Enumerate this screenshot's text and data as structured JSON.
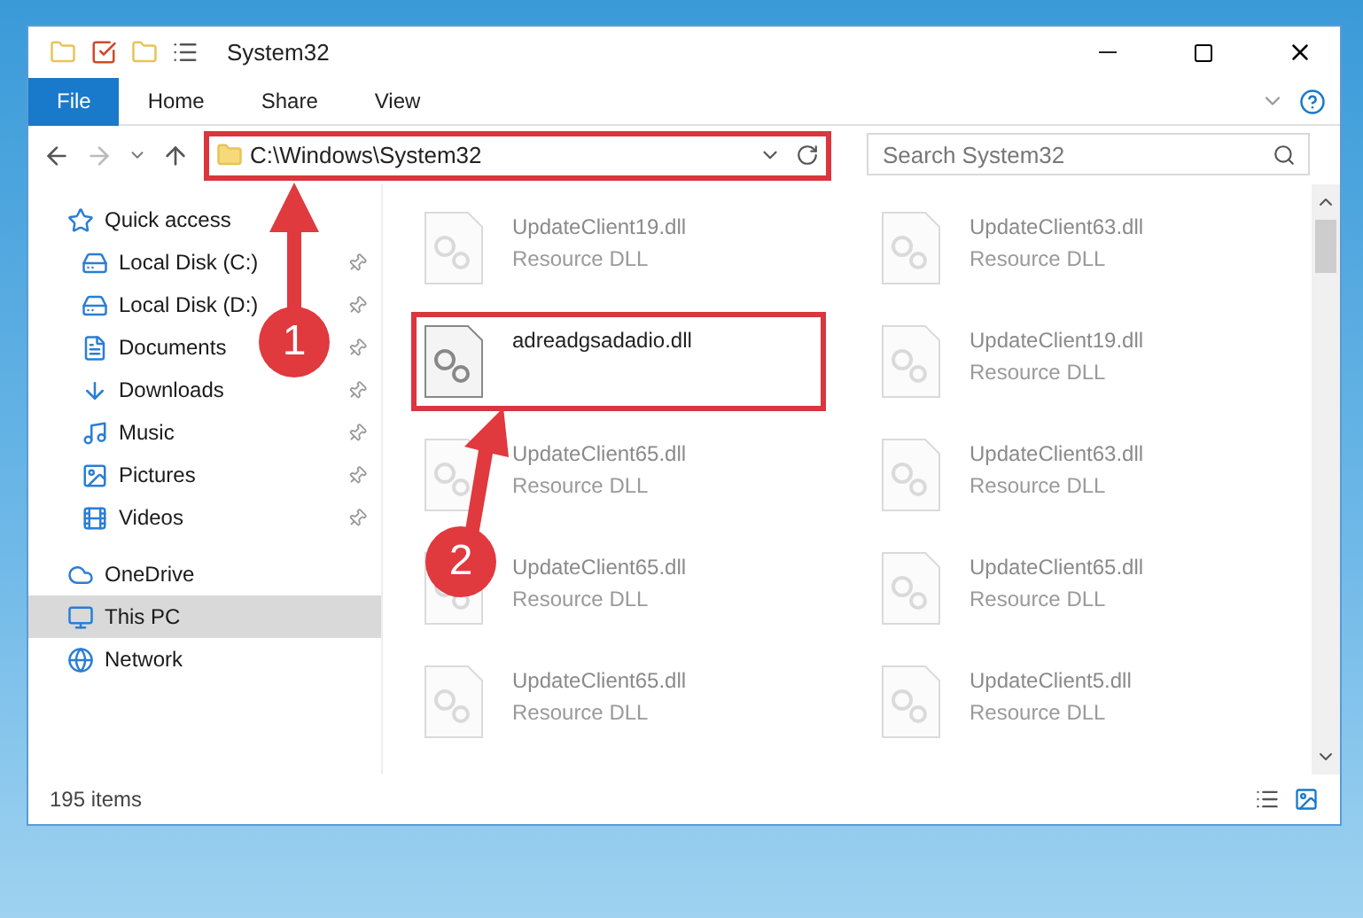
{
  "window": {
    "title": "System32"
  },
  "ribbon_tabs": [
    {
      "label": "File",
      "selected": true
    },
    {
      "label": "Home",
      "selected": false
    },
    {
      "label": "Share",
      "selected": false
    },
    {
      "label": "View",
      "selected": false
    }
  ],
  "address_bar": {
    "path": "C:\\Windows\\System32",
    "highlighted": true
  },
  "search": {
    "placeholder": "Search System32"
  },
  "nav_pane": [
    {
      "label": "Quick access",
      "selected": false,
      "children": [
        {
          "label": "Local Disk (C:)",
          "pinned": true,
          "selected": false
        },
        {
          "label": "Local Disk (D:)",
          "pinned": true,
          "selected": false
        },
        {
          "label": "Documents",
          "pinned": true,
          "selected": false
        },
        {
          "label": "Downloads",
          "pinned": true,
          "selected": false
        },
        {
          "label": "Music",
          "pinned": true,
          "selected": false
        },
        {
          "label": "Pictures",
          "pinned": true,
          "selected": false
        },
        {
          "label": "Videos",
          "pinned": true,
          "selected": false
        }
      ]
    },
    {
      "label": "OneDrive",
      "selected": false
    },
    {
      "label": "This PC",
      "selected": true
    },
    {
      "label": "Network",
      "selected": false
    }
  ],
  "files": [
    {
      "name": "UpdateClient19.dll",
      "type": "Resource DLL",
      "faded": true,
      "highlighted": false
    },
    {
      "name": "UpdateClient63.dll",
      "type": "Resource DLL",
      "faded": true,
      "highlighted": false
    },
    {
      "name": "adreadgsadadio.dll",
      "faded": false,
      "highlighted": true
    },
    {
      "name": "UpdateClient19.dll",
      "type": "Resource DLL",
      "faded": true,
      "highlighted": false
    },
    {
      "name": "UpdateClient65.dll",
      "type": "Resource DLL",
      "faded": true,
      "highlighted": false
    },
    {
      "name": "UpdateClient63.dll",
      "type": "Resource DLL",
      "faded": true,
      "highlighted": false
    },
    {
      "name": "UpdateClient65.dll",
      "type": "Resource DLL",
      "faded": true,
      "highlighted": false
    },
    {
      "name": "UpdateClient65.dll",
      "type": "Resource DLL",
      "faded": true,
      "highlighted": false
    },
    {
      "name": "UpdateClient65.dll",
      "type": "Resource DLL",
      "faded": true,
      "highlighted": false
    },
    {
      "name": "UpdateClient5.dll",
      "type": "Resource DLL",
      "faded": true,
      "highlighted": false
    }
  ],
  "status_bar": {
    "item_count": "195 items"
  },
  "annotations": [
    {
      "number": "1"
    },
    {
      "number": "2"
    }
  ]
}
